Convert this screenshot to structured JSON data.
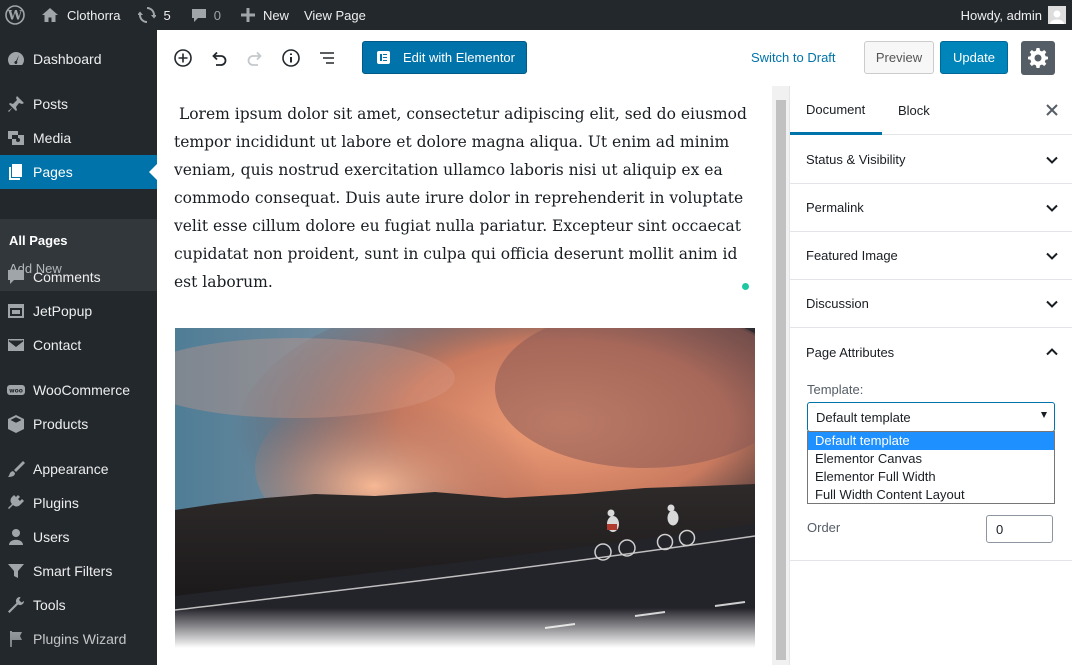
{
  "adminbar": {
    "site_name": "Clothorra",
    "updates_count": "5",
    "comments_count": "0",
    "new_label": "New",
    "view_page_label": "View Page",
    "howdy": "Howdy, admin"
  },
  "sidebar": {
    "items": [
      {
        "label": "Dashboard",
        "icon": "dashboard-icon"
      },
      {
        "label": "Posts",
        "icon": "pin-icon"
      },
      {
        "label": "Media",
        "icon": "media-icon"
      },
      {
        "label": "Pages",
        "icon": "pages-icon"
      },
      {
        "label": "Comments",
        "icon": "comment-icon"
      },
      {
        "label": "JetPopup",
        "icon": "popup-icon"
      },
      {
        "label": "Contact",
        "icon": "mail-icon"
      },
      {
        "label": "WooCommerce",
        "icon": "woocommerce-icon"
      },
      {
        "label": "Products",
        "icon": "box-icon"
      },
      {
        "label": "Appearance",
        "icon": "brush-icon"
      },
      {
        "label": "Plugins",
        "icon": "plug-icon"
      },
      {
        "label": "Users",
        "icon": "user-icon"
      },
      {
        "label": "Smart Filters",
        "icon": "filter-icon"
      },
      {
        "label": "Tools",
        "icon": "wrench-icon"
      },
      {
        "label": "Plugins Wizard",
        "icon": "flag-icon"
      }
    ],
    "submenu": [
      "All Pages",
      "Add New"
    ],
    "active_color": "#0073aa"
  },
  "toolbar": {
    "elementor_label": "Edit with Elementor",
    "switch_draft_label": "Switch to Draft",
    "preview_label": "Preview",
    "update_label": "Update"
  },
  "editor": {
    "paragraph": " Lorem ipsum dolor sit amet, consectetur adipiscing elit, sed do eiusmod tempor incididunt ut labore et dolore magna aliqua. Ut enim ad minim veniam, quis nostrud exercitation ullamco laboris nisi ut aliquip ex ea commodo consequat. Duis aute irure dolor in reprehenderit in voluptate velit esse cillum dolore eu fugiat nulla pariatur. Excepteur sint occaecat cupidatat non proident, sunt in culpa qui officia deserunt mollit anim id est laborum."
  },
  "panel": {
    "tabs": [
      "Document",
      "Block"
    ],
    "sections": [
      "Status & Visibility",
      "Permalink",
      "Featured Image",
      "Discussion",
      "Page Attributes"
    ],
    "template_label": "Template:",
    "template_selected": "Default template",
    "template_options": [
      "Default template",
      "Elementor Canvas",
      "Elementor Full Width",
      "Full Width Content Layout"
    ],
    "order_label": "Order",
    "order_value": "0"
  }
}
